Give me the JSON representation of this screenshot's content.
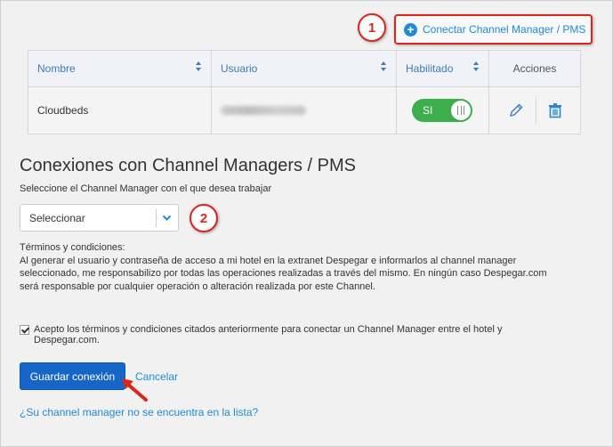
{
  "annotations": {
    "step1": "1",
    "step2": "2"
  },
  "toolbar": {
    "connect_label": "Conectar Channel Manager / PMS",
    "connect_icon": "plus-circle-icon"
  },
  "table": {
    "headers": [
      "Nombre",
      "Usuario",
      "Habilitado",
      "Acciones"
    ],
    "rows": [
      {
        "nombre": "Cloudbeds",
        "habilitado": "SI",
        "actions": [
          "edit-pencil-icon",
          "trash-icon"
        ]
      }
    ]
  },
  "main": {
    "title": "Conexiones con Channel Managers / PMS",
    "select_label": "Seleccione el Channel Manager con el que desea trabajar",
    "select_value": "Seleccionar",
    "terms_title": "Términos y condiciones:",
    "terms_text": "Al generar el usuario y contraseña de acceso a mi hotel en la extranet Despegar e informarlos al channel manager seleccionado, me responsabilizo por todas las operaciones realizadas a través del mismo. En ningún caso Despegar.com será responsable por cualquier operación o alteración realizada por este Channel.",
    "accept_text": "Acepto los términos y condiciones citados anteriormente para conectar un Channel Manager entre el hotel y Despegar.com.",
    "accept_checked": true,
    "save_label": "Guardar conexión",
    "cancel_label": "Cancelar",
    "missing_link": "¿Su channel manager no se encuentra en la lista?"
  },
  "colors": {
    "accent": "#1f8bd8",
    "primary_button": "#1766c7",
    "toggle_on": "#3cae4c",
    "annotation": "#d9271c"
  }
}
